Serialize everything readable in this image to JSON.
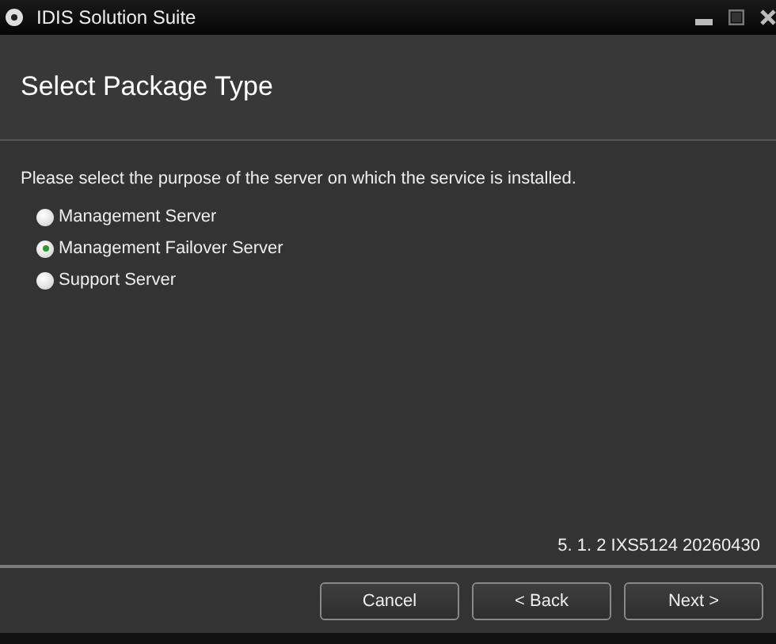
{
  "window": {
    "title": "IDIS Solution Suite"
  },
  "header": {
    "title": "Select Package Type"
  },
  "prompt": "Please select the purpose of the server on which the service is installed.",
  "options": [
    {
      "label": "Management Server",
      "selected": false
    },
    {
      "label": "Management Failover Server",
      "selected": true
    },
    {
      "label": "Support Server",
      "selected": false
    }
  ],
  "version": "5. 1. 2 IXS5124 20260430",
  "buttons": [
    "Cancel",
    "< Back",
    "Next >"
  ]
}
